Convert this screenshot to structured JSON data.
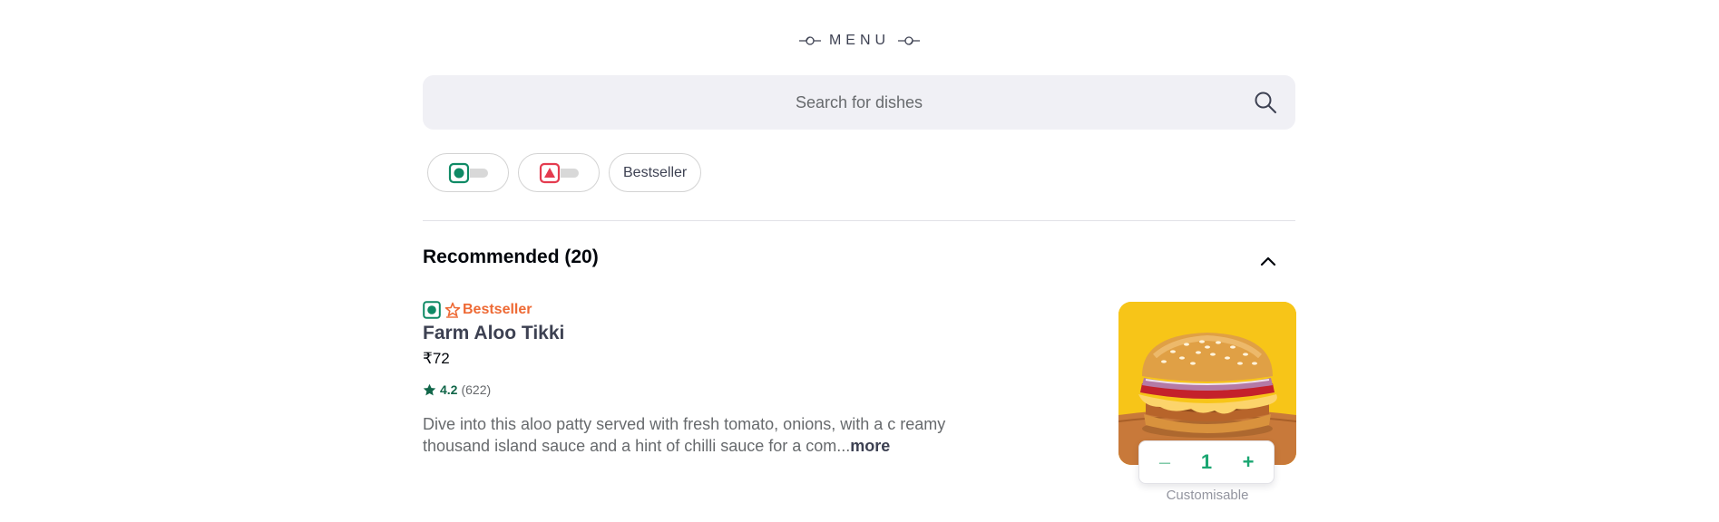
{
  "menu": {
    "heading": "MENU"
  },
  "search": {
    "placeholder": "Search for dishes"
  },
  "filters": [
    {
      "type": "veg-toggle",
      "icon": "veg-icon",
      "color": "#0f8a65"
    },
    {
      "type": "nonveg-toggle",
      "icon": "nonveg-icon",
      "color": "#e43b4f"
    },
    {
      "type": "text",
      "label": "Bestseller"
    }
  ],
  "section": {
    "title": "Recommended (20)",
    "collapsed": false
  },
  "items": [
    {
      "tag": "Bestseller",
      "diet": "veg",
      "name": "Farm Aloo Tikki",
      "price": "₹72",
      "rating": "4.2",
      "rating_count": "(622)",
      "description": "Dive into this aloo patty served with fresh tomato, onions, with a c reamy thousand island sauce and a hint of chilli sauce for a com...",
      "more_label": "more",
      "quantity": "1",
      "minus_label": "–",
      "plus_label": "+",
      "customisable_label": "Customisable"
    }
  ],
  "colors": {
    "veg": "#0f8a65",
    "nonveg": "#e43b4f",
    "bestseller": "#ee6a35",
    "accent_green": "#1ba672",
    "search_bg": "#f0f0f5"
  }
}
